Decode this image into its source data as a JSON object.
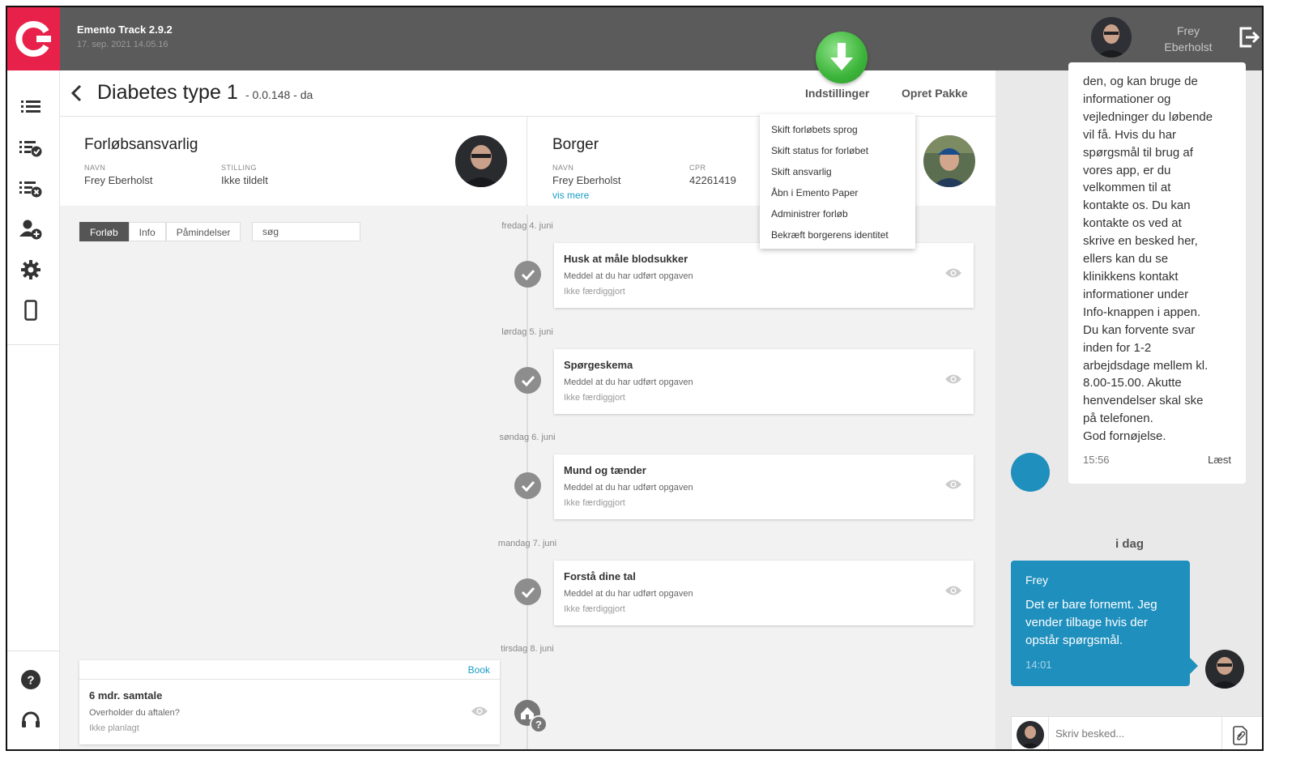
{
  "header": {
    "app_name": "Emento Track 2.9.2",
    "app_date": "17. sep. 2021 14.05.16",
    "user_first": "Frey",
    "user_last": "Eberholst"
  },
  "title": {
    "name": "Diabetes type 1",
    "subtitle": "- 0.0.148 - da",
    "settings_label": "Indstillinger",
    "create_package_label": "Opret Pakke"
  },
  "responsible": {
    "title": "Forløbsansvarlig",
    "name_label": "NAVN",
    "name_value": "Frey Eberholst",
    "position_label": "STILLING",
    "position_value": "Ikke tildelt"
  },
  "citizen": {
    "title": "Borger",
    "name_label": "NAVN",
    "name_value": "Frey Eberholst",
    "cpr_label": "CPR",
    "cpr_value": "42261419",
    "more_link": "vis mere"
  },
  "tabs": [
    "Forløb",
    "Info",
    "Påmindelser"
  ],
  "search_placeholder": "søg",
  "days": [
    "fredag 4. juni",
    "lørdag 5. juni",
    "søndag 6. juni",
    "mandag 7. juni",
    "tirsdag 8. juni"
  ],
  "tasks": [
    {
      "title": "Husk at måle blodsukker",
      "desc": "Meddel at du har udført opgaven",
      "status": "Ikke færdiggjort"
    },
    {
      "title": "Spørgeskema",
      "desc": "Meddel at du har udført opgaven",
      "status": "Ikke færdiggjort"
    },
    {
      "title": "Mund og tænder",
      "desc": "Meddel at du har udført opgaven",
      "status": "Ikke færdiggjort"
    },
    {
      "title": "Forstå dine tal",
      "desc": "Meddel at du har udført opgaven",
      "status": "Ikke færdiggjort"
    }
  ],
  "appointment": {
    "book_label": "Book",
    "title": "6 mdr. samtale",
    "desc": "Overholder du aftalen?",
    "status": "Ikke planlagt"
  },
  "dropdown": [
    "Skift forløbets sprog",
    "Skift status for forløbet",
    "Skift ansvarlig",
    "Åbn i Emento Paper",
    "Administrer forløb",
    "Bekræft borgerens identitet"
  ],
  "chat": {
    "incoming_text": "den, og kan bruge de\ninformationer og\nvejledninger du løbende\nvil få.  Hvis du har\nspørgsmål til brug af\nvores app, er du\nvelkommen til at\nkontakte os.  Du kan\nkontakte os ved at\nskrive en besked her,\nellers kan du se\nklinikkens kontakt\ninformationer under\nInfo-knappen i appen.\nDu kan forvente svar\ninden for 1-2\narbejdsdage mellem kl.\n8.00-15.00.  Akutte\nhenvendelser skal ske\npå telefonen.\nGod fornøjelse.",
    "incoming_time": "15:56",
    "incoming_status": "Læst",
    "today_label": "i dag",
    "outgoing_name": "Frey",
    "outgoing_text": "Det er bare fornemt. Jeg vender tilbage hvis der opstår spørgsmål.",
    "outgoing_time": "14:01",
    "compose_placeholder": "Skriv besked..."
  },
  "colors": {
    "brand": "#e8214a",
    "topbar": "#5b5b5b",
    "accent": "#1f8fbd",
    "download_button": "#3cb43a"
  }
}
